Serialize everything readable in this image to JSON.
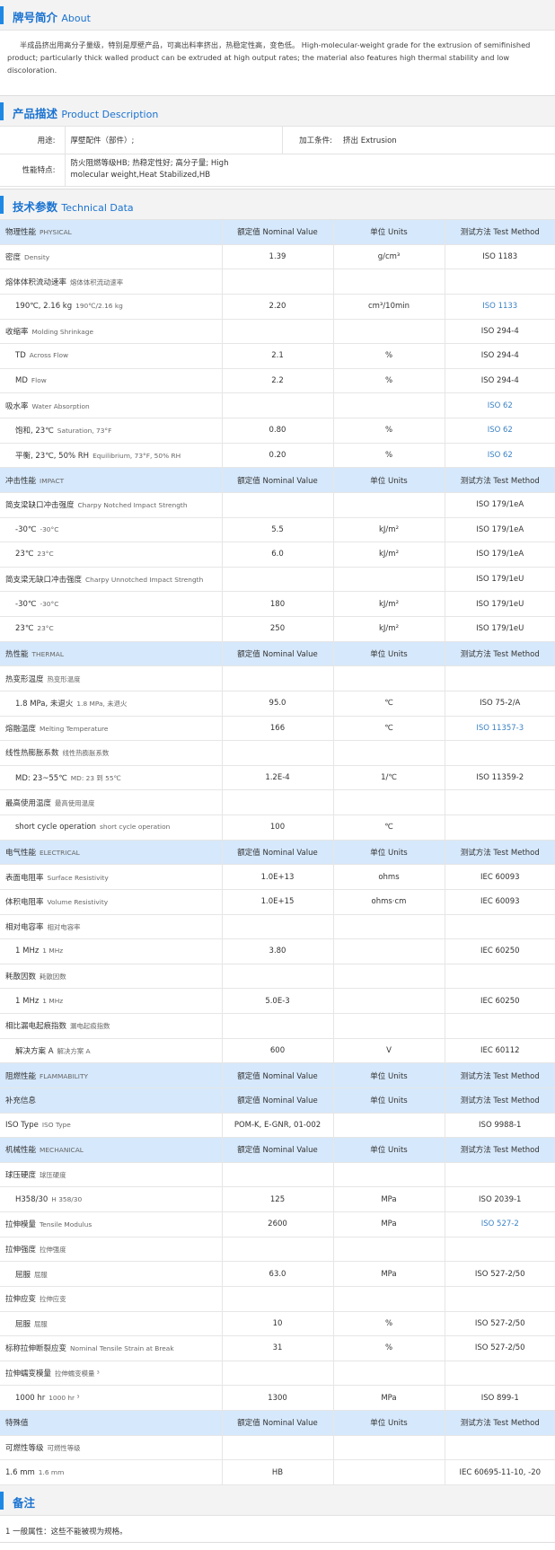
{
  "about": {
    "title_cn": "牌号简介",
    "title_en": "About",
    "text": "半成品挤出用高分子量级，特别是厚壁产品，可高出料率挤出，热稳定性高，变色低。  High-molecular-weight grade for the extrusion of semifinished product; particularly thick walled product can be extruded at high output rates; the material also features high thermal stability and low discoloration."
  },
  "description": {
    "title_cn": "产品描述",
    "title_en": "Product Description",
    "use_label": "用途:",
    "use_value": "厚壁配件（部件）;",
    "process_label": "加工条件:",
    "process_value": "挤出  Extrusion",
    "feature_label": "性能特点:",
    "feature_value": "防火阻燃等级HB; 热稳定性好; 高分子量;   High molecular weight,Heat Stabilized,HB"
  },
  "technical": {
    "title_cn": "技术参数",
    "title_en": "Technical Data",
    "rows": [
      {
        "type": "hdr",
        "name": "物理性能",
        "en": "PHYSICAL",
        "value": "额定值  Nominal Value",
        "unit": "单位  Units",
        "method": "测试方法  Test Method"
      },
      {
        "type": "main",
        "name": "密度",
        "en": "Density",
        "value": "1.39",
        "unit": "g/cm³",
        "method": "ISO 1183"
      },
      {
        "type": "main",
        "name": "熔体体积流动速率",
        "en": "熔体体积流动速率",
        "value": "",
        "unit": "",
        "method": ""
      },
      {
        "type": "sub",
        "name": "190℃, 2.16 kg",
        "en": "190℃/2.16 kg",
        "value": "2.20",
        "unit": "cm³/10min",
        "method": "ISO 1133",
        "link": true
      },
      {
        "type": "main",
        "name": "收缩率",
        "en": "Molding Shrinkage",
        "value": "",
        "unit": "",
        "method": "ISO 294-4"
      },
      {
        "type": "sub",
        "name": "TD",
        "en": "Across Flow",
        "value": "2.1",
        "unit": "%",
        "method": "ISO 294-4"
      },
      {
        "type": "sub",
        "name": "MD",
        "en": "Flow",
        "value": "2.2",
        "unit": "%",
        "method": "ISO 294-4"
      },
      {
        "type": "main",
        "name": "吸水率",
        "en": "Water Absorption",
        "value": "",
        "unit": "",
        "method": "ISO 62",
        "link": true
      },
      {
        "type": "sub",
        "name": "饱和, 23℃",
        "en": "Saturation, 73°F",
        "value": "0.80",
        "unit": "%",
        "method": "ISO 62",
        "link": true
      },
      {
        "type": "sub",
        "name": "平衡, 23℃, 50% RH",
        "en": "Equilibrium, 73°F, 50% RH",
        "value": "0.20",
        "unit": "%",
        "method": "ISO 62",
        "link": true
      },
      {
        "type": "hdr",
        "name": "冲击性能",
        "en": "IMPACT",
        "value": "额定值  Nominal Value",
        "unit": "单位  Units",
        "method": "测试方法  Test Method"
      },
      {
        "type": "main",
        "name": "简支梁缺口冲击强度",
        "en": "Charpy Notched Impact Strength",
        "value": "",
        "unit": "",
        "method": "ISO 179/1eA"
      },
      {
        "type": "sub",
        "name": "-30℃",
        "en": "-30°C",
        "value": "5.5",
        "unit": "kJ/m²",
        "method": "ISO 179/1eA"
      },
      {
        "type": "sub",
        "name": "23℃",
        "en": "23°C",
        "value": "6.0",
        "unit": "kJ/m²",
        "method": "ISO 179/1eA"
      },
      {
        "type": "main",
        "name": "简支梁无缺口冲击强度",
        "en": "Charpy Unnotched Impact Strength",
        "value": "",
        "unit": "",
        "method": "ISO 179/1eU"
      },
      {
        "type": "sub",
        "name": "-30℃",
        "en": "-30°C",
        "value": "180",
        "unit": "kJ/m²",
        "method": "ISO 179/1eU"
      },
      {
        "type": "sub",
        "name": "23℃",
        "en": "23°C",
        "value": "250",
        "unit": "kJ/m²",
        "method": "ISO 179/1eU"
      },
      {
        "type": "hdr",
        "name": "热性能",
        "en": "THERMAL",
        "value": "额定值  Nominal Value",
        "unit": "单位  Units",
        "method": "测试方法  Test Method"
      },
      {
        "type": "main",
        "name": "热变形温度",
        "en": "热变形温度",
        "value": "",
        "unit": "",
        "method": ""
      },
      {
        "type": "sub",
        "name": "1.8 MPa, 未退火",
        "en": "1.8 MPa, 未退火",
        "value": "95.0",
        "unit": "℃",
        "method": "ISO 75-2/A"
      },
      {
        "type": "main",
        "name": "熔融温度",
        "en": "Melting Temperature",
        "value": "166",
        "unit": "℃",
        "method": "ISO 11357-3",
        "link": true
      },
      {
        "type": "main",
        "name": "线性热膨胀系数",
        "en": "线性热膨胀系数",
        "value": "",
        "unit": "",
        "method": ""
      },
      {
        "type": "sub",
        "name": "MD: 23~55℃",
        "en": "MD: 23 到 55℃",
        "value": "1.2E-4",
        "unit": "1/℃",
        "method": "ISO 11359-2"
      },
      {
        "type": "main",
        "name": "最高使用温度",
        "en": "最高使用温度",
        "value": "",
        "unit": "",
        "method": ""
      },
      {
        "type": "sub",
        "name": "short cycle operation",
        "en": "short cycle operation",
        "value": "100",
        "unit": "℃",
        "method": ""
      },
      {
        "type": "hdr",
        "name": "电气性能",
        "en": "ELECTRICAL",
        "value": "额定值  Nominal Value",
        "unit": "单位  Units",
        "method": "测试方法  Test Method"
      },
      {
        "type": "main",
        "name": "表面电阻率",
        "en": "Surface Resistivity",
        "value": "1.0E+13",
        "unit": "ohms",
        "method": "IEC 60093"
      },
      {
        "type": "main",
        "name": "体积电阻率",
        "en": "Volume Resistivity",
        "value": "1.0E+15",
        "unit": "ohms·cm",
        "method": "IEC 60093"
      },
      {
        "type": "main",
        "name": "相对电容率",
        "en": "相对电容率",
        "value": "",
        "unit": "",
        "method": ""
      },
      {
        "type": "sub",
        "name": "1 MHz",
        "en": "1 MHz",
        "value": "3.80",
        "unit": "",
        "method": "IEC 60250"
      },
      {
        "type": "main",
        "name": "耗散因数",
        "en": "耗散因数",
        "value": "",
        "unit": "",
        "method": ""
      },
      {
        "type": "sub",
        "name": "1 MHz",
        "en": "1 MHz",
        "value": "5.0E-3",
        "unit": "",
        "method": "IEC 60250"
      },
      {
        "type": "main",
        "name": "相比漏电起痕指数",
        "en": "漏电起痕指数",
        "value": "",
        "unit": "",
        "method": ""
      },
      {
        "type": "sub",
        "name": "解决方案 A",
        "en": "解决方案 A",
        "value": "600",
        "unit": "V",
        "method": "IEC 60112"
      },
      {
        "type": "hdr",
        "name": "阻燃性能",
        "en": "FLAMMABILITY",
        "value": "额定值  Nominal Value",
        "unit": "单位  Units",
        "method": "测试方法  Test Method"
      },
      {
        "type": "hdr",
        "name": "补充信息",
        "en": "",
        "value": "额定值  Nominal Value",
        "unit": "单位  Units",
        "method": "测试方法  Test Method"
      },
      {
        "type": "main",
        "name": "ISO Type",
        "en": "ISO Type",
        "value": "POM-K, E-GNR, 01-002",
        "unit": "",
        "method": "ISO 9988-1"
      },
      {
        "type": "hdr",
        "name": "机械性能",
        "en": "MECHANICAL",
        "value": "额定值  Nominal Value",
        "unit": "单位  Units",
        "method": "测试方法  Test Method"
      },
      {
        "type": "main",
        "name": "球压硬度",
        "en": "球压硬度",
        "value": "",
        "unit": "",
        "method": ""
      },
      {
        "type": "sub",
        "name": "H358/30",
        "en": "H 358/30",
        "value": "125",
        "unit": "MPa",
        "method": "ISO 2039-1"
      },
      {
        "type": "main",
        "name": "拉伸模量",
        "en": "Tensile Modulus",
        "value": "2600",
        "unit": "MPa",
        "method": "ISO 527-2",
        "link": true
      },
      {
        "type": "main",
        "name": "拉伸强度",
        "en": "拉伸强度",
        "value": "",
        "unit": "",
        "method": ""
      },
      {
        "type": "sub",
        "name": "屈服",
        "en": "屈服",
        "value": "63.0",
        "unit": "MPa",
        "method": "ISO 527-2/50"
      },
      {
        "type": "main",
        "name": "拉伸应变",
        "en": "拉伸应变",
        "value": "",
        "unit": "",
        "method": ""
      },
      {
        "type": "sub",
        "name": "屈服",
        "en": "屈服",
        "value": "10",
        "unit": "%",
        "method": "ISO 527-2/50"
      },
      {
        "type": "main",
        "name": "标称拉伸断裂应变",
        "en": "Nominal Tensile Strain at Break",
        "value": "31",
        "unit": "%",
        "method": "ISO 527-2/50"
      },
      {
        "type": "main",
        "name": "拉伸蠕变模量",
        "en": "拉伸蠕变模量 ³",
        "value": "",
        "unit": "",
        "method": ""
      },
      {
        "type": "sub",
        "name": "1000 hr",
        "en": "1000 hr ³",
        "value": "1300",
        "unit": "MPa",
        "method": "ISO 899-1"
      },
      {
        "type": "hdr",
        "name": "特殊值",
        "en": "",
        "value": "额定值  Nominal Value",
        "unit": "单位  Units",
        "method": "测试方法  Test Method"
      },
      {
        "type": "main",
        "name": "可燃性等级",
        "en": "可燃性等级",
        "value": "",
        "unit": "",
        "method": ""
      },
      {
        "type": "plain",
        "name": "1.6 mm",
        "en": "1.6 mm",
        "value": "HB",
        "unit": "",
        "method": "IEC 60695-11-10, -20"
      }
    ]
  },
  "notes": {
    "title": "备注",
    "text": "1 一般属性：这些不能被视为规格。"
  },
  "colors": {
    "accent": "#1e88e5",
    "header_row": "#d6e8fb",
    "link": "#3b82c4"
  }
}
